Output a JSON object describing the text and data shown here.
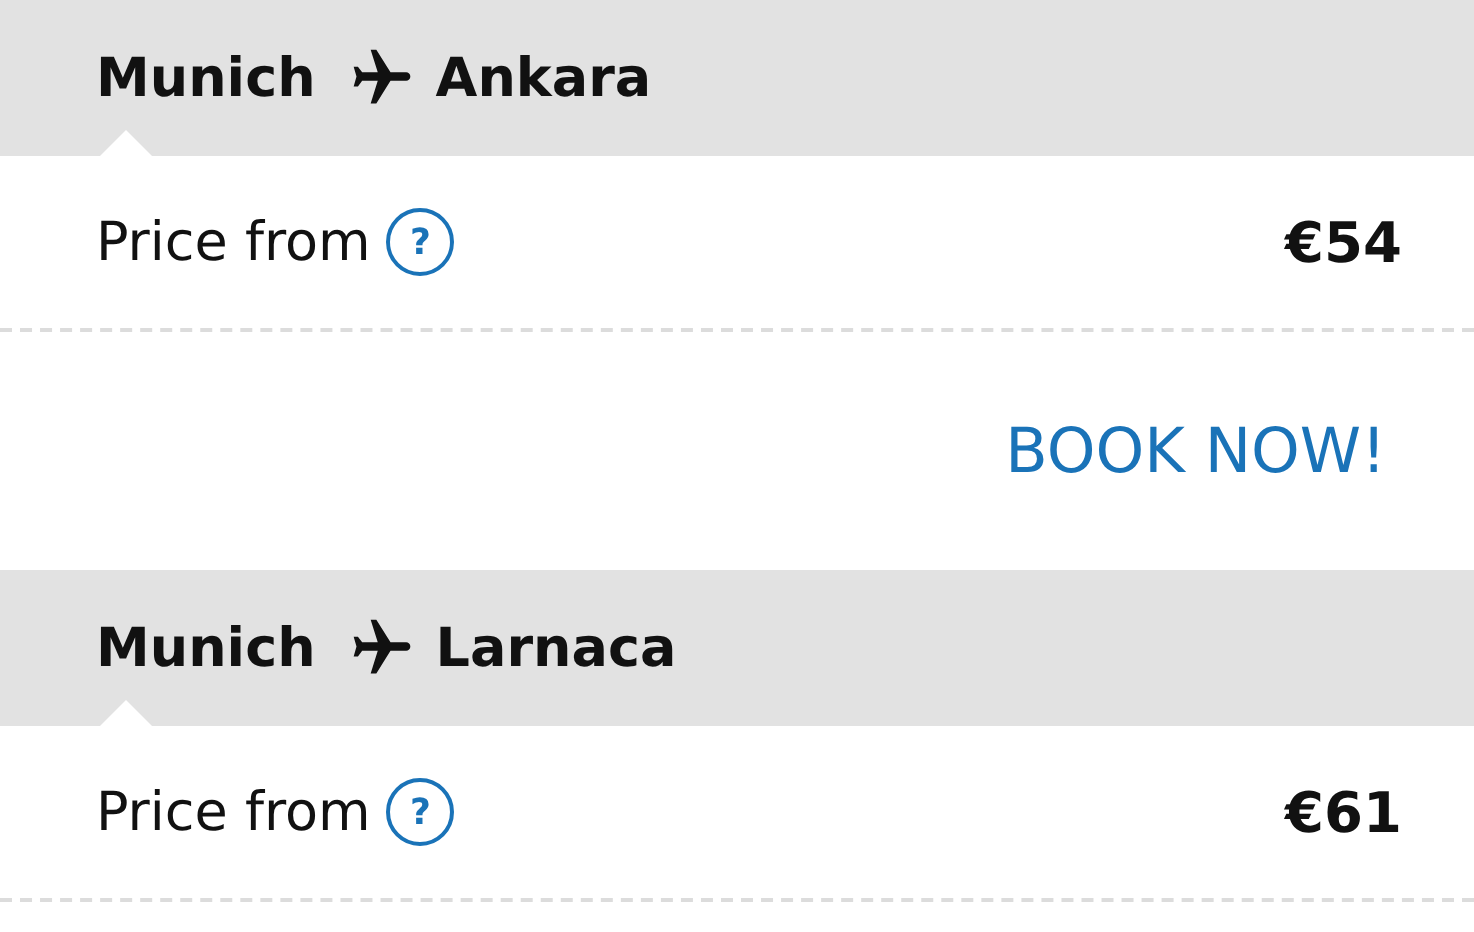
{
  "routes": [
    {
      "origin": "Munich",
      "destination": "Ankara",
      "price_label": "Price from",
      "help": "?",
      "price": "€54",
      "action": "BOOK NOW!"
    },
    {
      "origin": "Munich",
      "destination": "Larnaca",
      "price_label": "Price from",
      "help": "?",
      "price": "€61"
    }
  ]
}
